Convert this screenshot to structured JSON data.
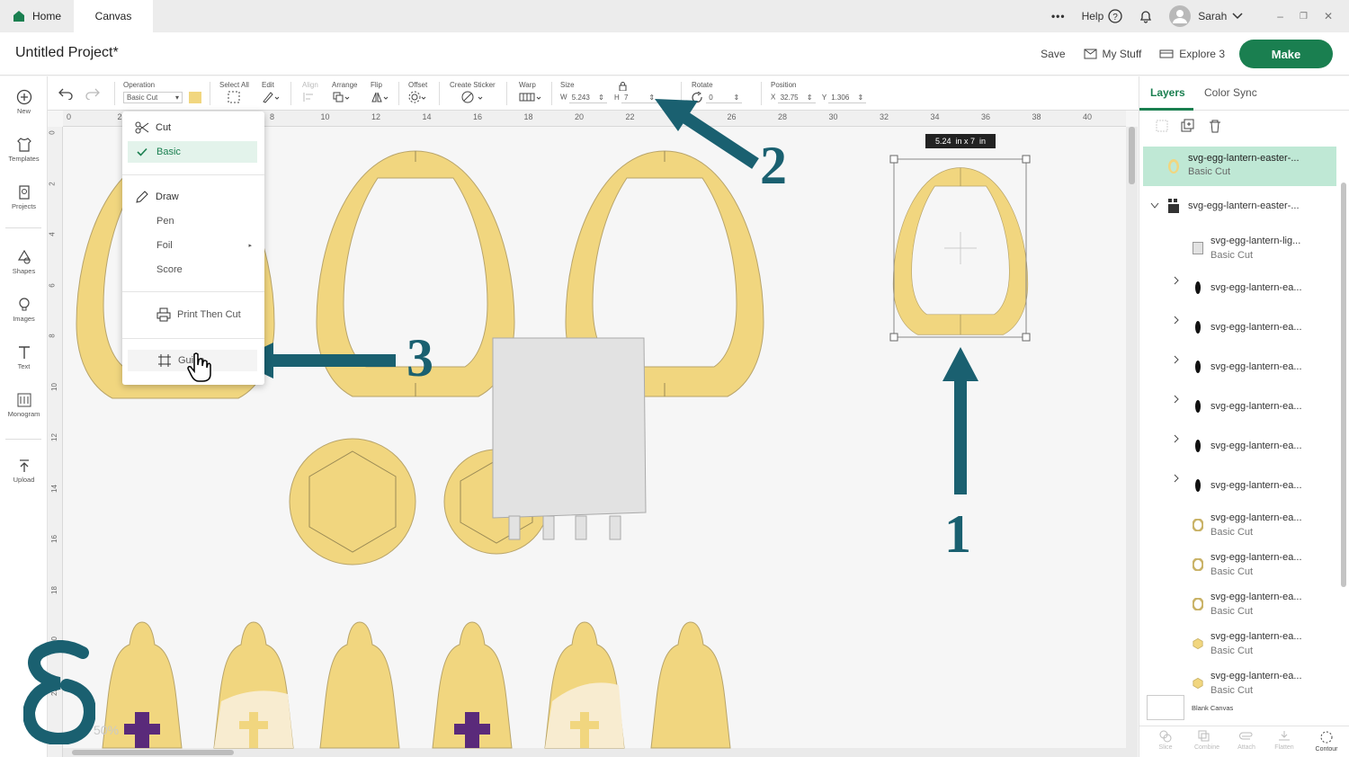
{
  "titlebar": {
    "tab_home": "Home",
    "tab_canvas": "Canvas",
    "more": "•••",
    "help": "Help",
    "user": "Sarah"
  },
  "header": {
    "title": "Untitled Project*",
    "save": "Save",
    "mystuff": "My Stuff",
    "explore": "Explore 3",
    "make": "Make"
  },
  "toolbar": {
    "operation_label": "Operation",
    "operation_value": "Basic Cut",
    "selectall": "Select All",
    "edit": "Edit",
    "align": "Align",
    "arrange": "Arrange",
    "flip": "Flip",
    "offset": "Offset",
    "create_sticker": "Create Sticker",
    "warp": "Warp",
    "size": "Size",
    "w_label": "W",
    "w_value": "5.243",
    "h_label": "H",
    "h_value": "7",
    "rotate": "Rotate",
    "rotate_value": "0",
    "position": "Position",
    "x_label": "X",
    "x_value": "32.75",
    "y_label": "Y",
    "y_value": "1.306"
  },
  "leftbar": [
    "New",
    "Templates",
    "Projects",
    "Shapes",
    "Images",
    "Text",
    "Monogram",
    "Upload"
  ],
  "ruler_h": [
    "0",
    "2",
    "4",
    "6",
    "8",
    "10",
    "12",
    "14",
    "16",
    "18",
    "20",
    "22",
    "24",
    "26",
    "28",
    "30",
    "32",
    "34",
    "36",
    "38",
    "40"
  ],
  "ruler_v": [
    "0",
    "2",
    "4",
    "6",
    "8",
    "10",
    "12",
    "14",
    "16",
    "18",
    "20",
    "22"
  ],
  "dropdown": {
    "cut": "Cut",
    "basic": "Basic",
    "draw": "Draw",
    "pen": "Pen",
    "foil": "Foil",
    "score": "Score",
    "print_then_cut": "Print Then Cut",
    "guide": "Guide"
  },
  "canvas": {
    "size_tooltip": "5.24  in x 7  in",
    "zoom": "50%"
  },
  "annotations": {
    "a1": "1",
    "a2": "2",
    "a3": "3"
  },
  "rightpanel": {
    "tab_layers": "Layers",
    "tab_color_sync": "Color Sync",
    "selected_layer": "svg-egg-lantern-easter-...",
    "selected_sub": "Basic Cut",
    "group": "svg-egg-lantern-easter-...",
    "layers": [
      {
        "name": "svg-egg-lantern-lig...",
        "sub": "Basic Cut",
        "swatch": "#dedede",
        "shape": "rect",
        "chevron": false
      },
      {
        "name": "svg-egg-lantern-ea...",
        "sub": "",
        "swatch": "#111111",
        "shape": "dark",
        "chevron": true
      },
      {
        "name": "svg-egg-lantern-ea...",
        "sub": "",
        "swatch": "#111111",
        "shape": "dark",
        "chevron": true
      },
      {
        "name": "svg-egg-lantern-ea...",
        "sub": "",
        "swatch": "#111111",
        "shape": "dark",
        "chevron": true
      },
      {
        "name": "svg-egg-lantern-ea...",
        "sub": "",
        "swatch": "#111111",
        "shape": "dark",
        "chevron": true
      },
      {
        "name": "svg-egg-lantern-ea...",
        "sub": "",
        "swatch": "#111111",
        "shape": "dark",
        "chevron": true
      },
      {
        "name": "svg-egg-lantern-ea...",
        "sub": "",
        "swatch": "#111111",
        "shape": "dark",
        "chevron": true
      },
      {
        "name": "svg-egg-lantern-ea...",
        "sub": "Basic Cut",
        "swatch": "#f1d67f",
        "shape": "ring",
        "chevron": false
      },
      {
        "name": "svg-egg-lantern-ea...",
        "sub": "Basic Cut",
        "swatch": "#f1d67f",
        "shape": "ring",
        "chevron": false
      },
      {
        "name": "svg-egg-lantern-ea...",
        "sub": "Basic Cut",
        "swatch": "#f1d67f",
        "shape": "ring",
        "chevron": false
      },
      {
        "name": "svg-egg-lantern-ea...",
        "sub": "Basic Cut",
        "swatch": "#f1d67f",
        "shape": "hex",
        "chevron": false
      },
      {
        "name": "svg-egg-lantern-ea...",
        "sub": "Basic Cut",
        "swatch": "#f1d67f",
        "shape": "hex",
        "chevron": false
      }
    ],
    "blank_canvas": "Blank Canvas",
    "bottom_tools": [
      "Slice",
      "Combine",
      "Attach",
      "Flatten",
      "Contour"
    ]
  },
  "colors": {
    "accent": "#1a7f50",
    "arrow": "#1a6070",
    "egg": "#f1d67f",
    "egg_stroke": "#b8a46a"
  }
}
